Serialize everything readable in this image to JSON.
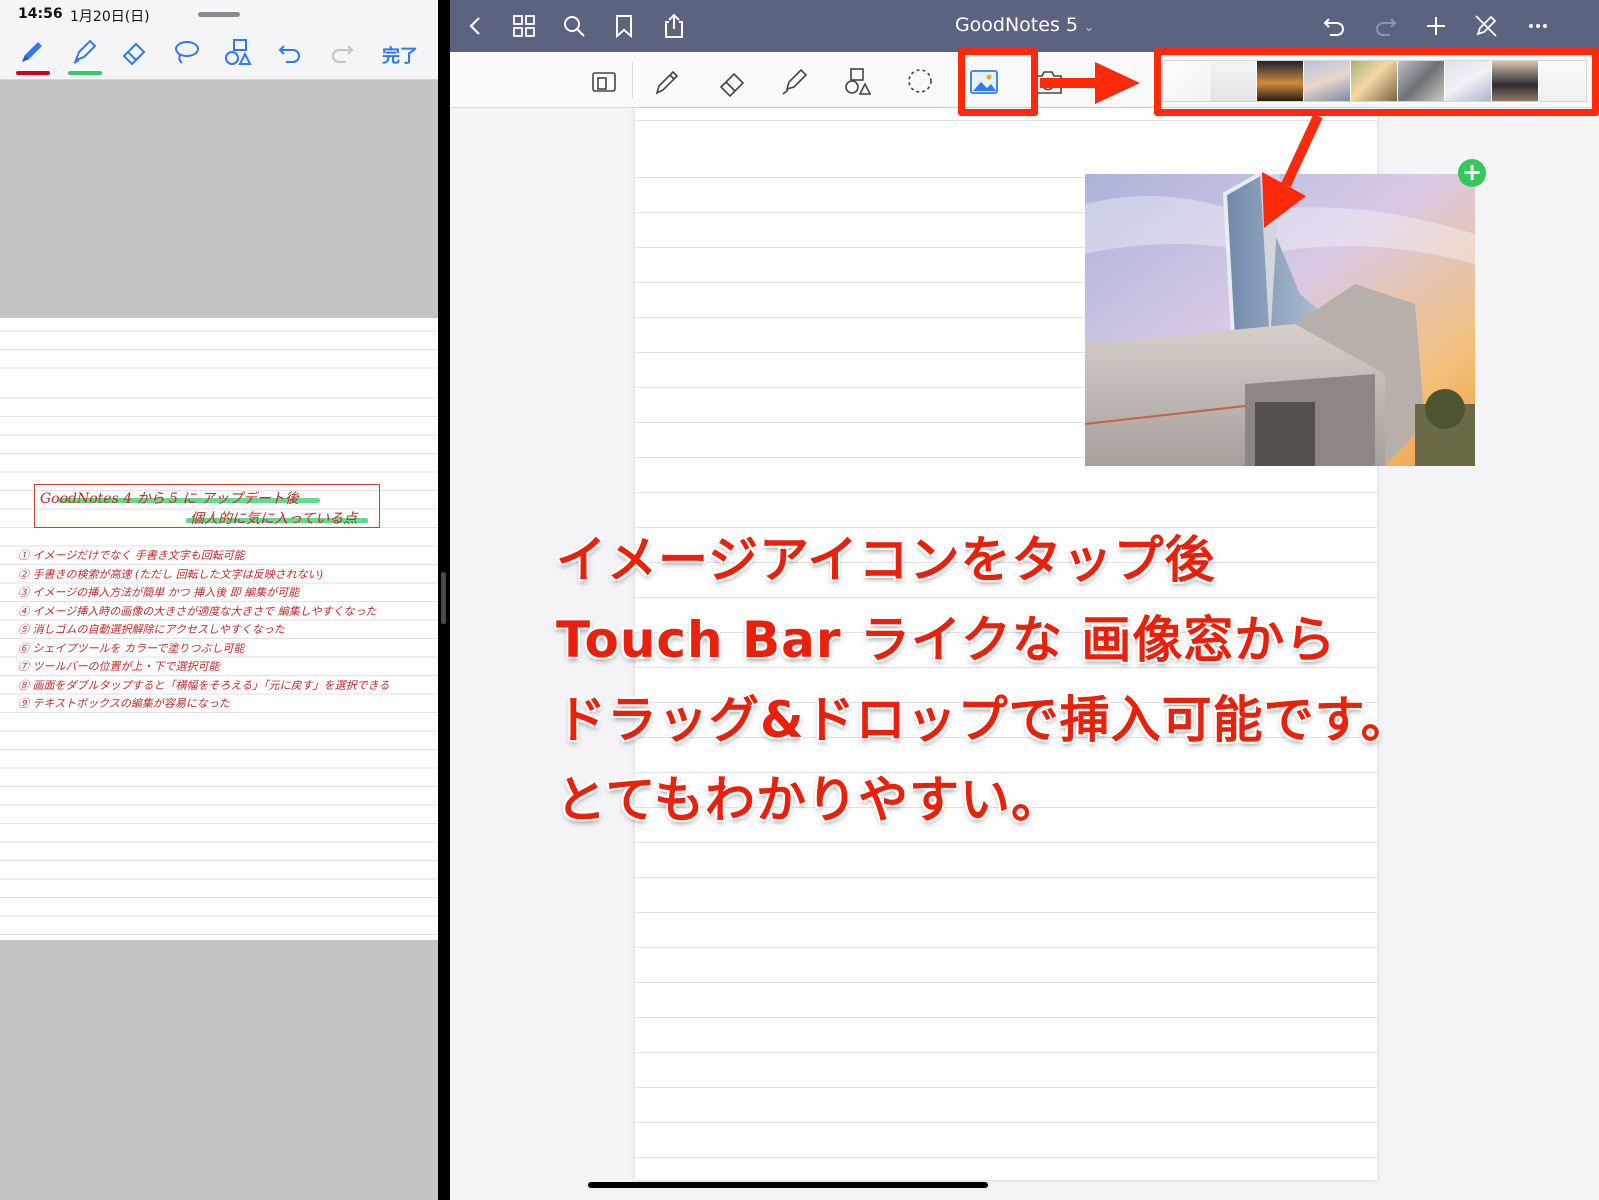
{
  "left_pane": {
    "status_time": "14:56",
    "status_date": "1月20日(日)",
    "toolbar": {
      "tools": [
        "pen-icon",
        "highlighter-icon",
        "eraser-icon",
        "lasso-icon",
        "shapes-icon",
        "undo-icon",
        "redo-icon"
      ],
      "pen_underline_color": "#d0021b",
      "highlighter_underline_color": "#37c86a",
      "done_label": "完了"
    },
    "note": {
      "title_line1": "GoodNotes 4 から 5 に アップデート後",
      "title_line2": "個人的に気に入っている点",
      "items": [
        "① イメージだけでなく 手書き文字も回転可能",
        "② 手書きの検索が高速 (ただし 回転した文字は反映されない)",
        "③ イメージの挿入方法が簡単 かつ 挿入後 即 編集が可能",
        "④ イメージ挿入時の画像の大きさが適度な大きさで 編集しやすくなった",
        "⑤ 消しゴムの自動選択解除にアクセスしやすくなった",
        "⑥ シェイプツールを カラーで塗りつぶし可能",
        "⑦ ツールバーの位置が上・下で選択可能",
        "⑧ 画面をダブルタップすると「横幅をそろえる」「元に戻す」を選択できる",
        "⑨ テキストボックスの編集が容易になった"
      ],
      "ink_color": "#c42a2a"
    }
  },
  "right_pane": {
    "nav": {
      "title": "GoodNotes 5",
      "title_chevron": "⌄",
      "left_icons": [
        "back-icon",
        "grid-icon",
        "search-icon",
        "bookmark-icon",
        "share-icon"
      ],
      "right_icons": [
        "undo-icon",
        "redo-icon",
        "add-icon",
        "pencil-off-icon",
        "more-icon"
      ],
      "bar_color": "#5b6381"
    },
    "tools": [
      "document-icon",
      "pen-icon",
      "eraser-icon",
      "highlighter-icon",
      "shapes-icon",
      "lasso-icon",
      "image-icon",
      "camera-icon"
    ],
    "photo_strip_count": 9,
    "add_badge": "+"
  },
  "annotation": {
    "lines": [
      "イメージアイコンをタップ後",
      "Touch Bar ライクな 画像窓から",
      "ドラッグ&ドロップで挿入可能です。",
      "とてもわかりやすい。"
    ],
    "color": "#e8210c"
  }
}
